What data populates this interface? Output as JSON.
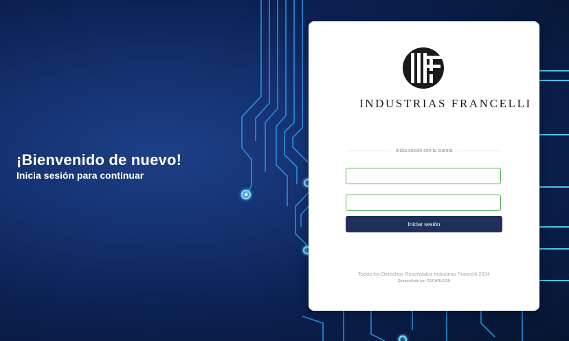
{
  "hero": {
    "title": "¡Bienvenido de nuevo!",
    "subtitle": "Inicia sesión para continuar"
  },
  "brand": {
    "name": "INDUSTRIAS FRANCELLI",
    "logo_icon": "if-monogram-logo"
  },
  "login": {
    "section_label": "Inicia sesión con tu cuenta",
    "username": {
      "value": "",
      "placeholder": ""
    },
    "password": {
      "value": "",
      "placeholder": ""
    },
    "submit_label": "Iniciar sesión"
  },
  "footer": {
    "copyright": "Todos los Derechos Reservados Industrias Francelli 2024",
    "credit": "Desarrollado por OSCARLEON"
  },
  "colors": {
    "background": "#0b2152",
    "circuit": "#2a9cf0",
    "glow": "#6fd6ff",
    "button": "#1f3158",
    "input_border": "#4caf50"
  }
}
